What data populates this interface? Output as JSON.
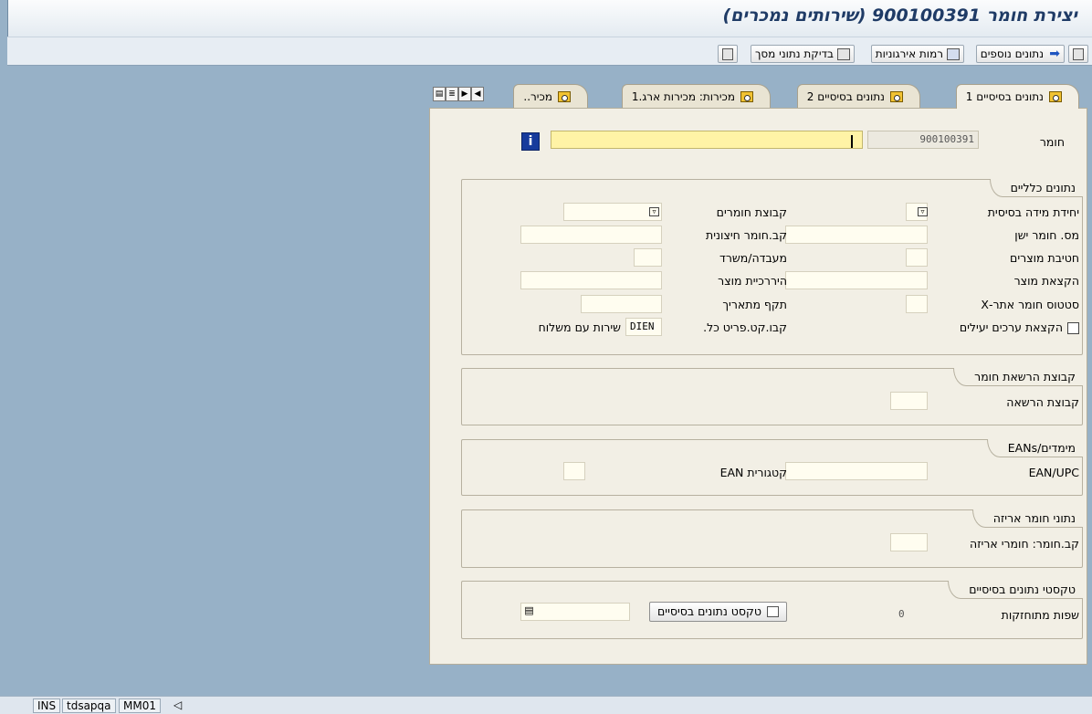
{
  "window": {
    "title": "יצירת חומר 900100391 (שירותים נמכרים)"
  },
  "toolbar": {
    "additional_data": "נתונים נוספים",
    "org_levels": "רמות אירגוניות",
    "check_screen_data": "בדיקת נתוני מסך"
  },
  "tabs": [
    {
      "label": "נתונים בסיסיים 1",
      "active": true
    },
    {
      "label": "נתונים בסיסיים 2",
      "active": false
    },
    {
      "label": "מכירות: מכירות ארג.1",
      "active": false
    },
    {
      "label": "מכיר..",
      "active": false
    }
  ],
  "header": {
    "material_label": "חומר",
    "material_value": "900100391",
    "description_value": ""
  },
  "general_data": {
    "title": "נתונים כלליים",
    "base_uom_label": "יחידת מידה בסיסית",
    "material_group_label": "קבוצת חומרים",
    "old_material_label": "מס. חומר ישן",
    "ext_material_group_label": "קב.חומר חיצונית",
    "division_label": "חטיבת מוצרים",
    "lab_office_label": "מעבדה/משרד",
    "product_allocation_label": "הקצאת מוצר",
    "product_hierarchy_label": "היררכיית מוצר",
    "x_plant_status_label": "סטטוס חומר אתר-X",
    "valid_from_label": "תקף מתאריך",
    "assign_eff_values_label": "הקצאת ערכים יעילים",
    "gen_item_cat_label": "קבו.קט.פריט כל.",
    "gen_item_cat_value": "DIEN",
    "gen_item_cat_text": "שירות עם משלוח"
  },
  "authorization_group": {
    "title": "קבוצת הרשאת חומר",
    "auth_group_label": "קבוצת הרשאה"
  },
  "dimensions": {
    "title": "מימדים/EANs",
    "ean_upc_label": "EAN/UPC",
    "ean_category_label": "קטגורית EAN"
  },
  "packaging": {
    "title": "נתוני חומר אריזה",
    "pack_group_label": "קב.חומר: חומרי אריזה"
  },
  "basic_data_texts": {
    "title": "טקסטי נתונים בסיסיים",
    "languages_label": "שפות מתוחזקות",
    "languages_count": "0",
    "button_label": "טקסט נתונים בסיסיים"
  },
  "statusbar": {
    "mode": "INS",
    "server": "tdsapqa",
    "transaction": "MM01"
  }
}
